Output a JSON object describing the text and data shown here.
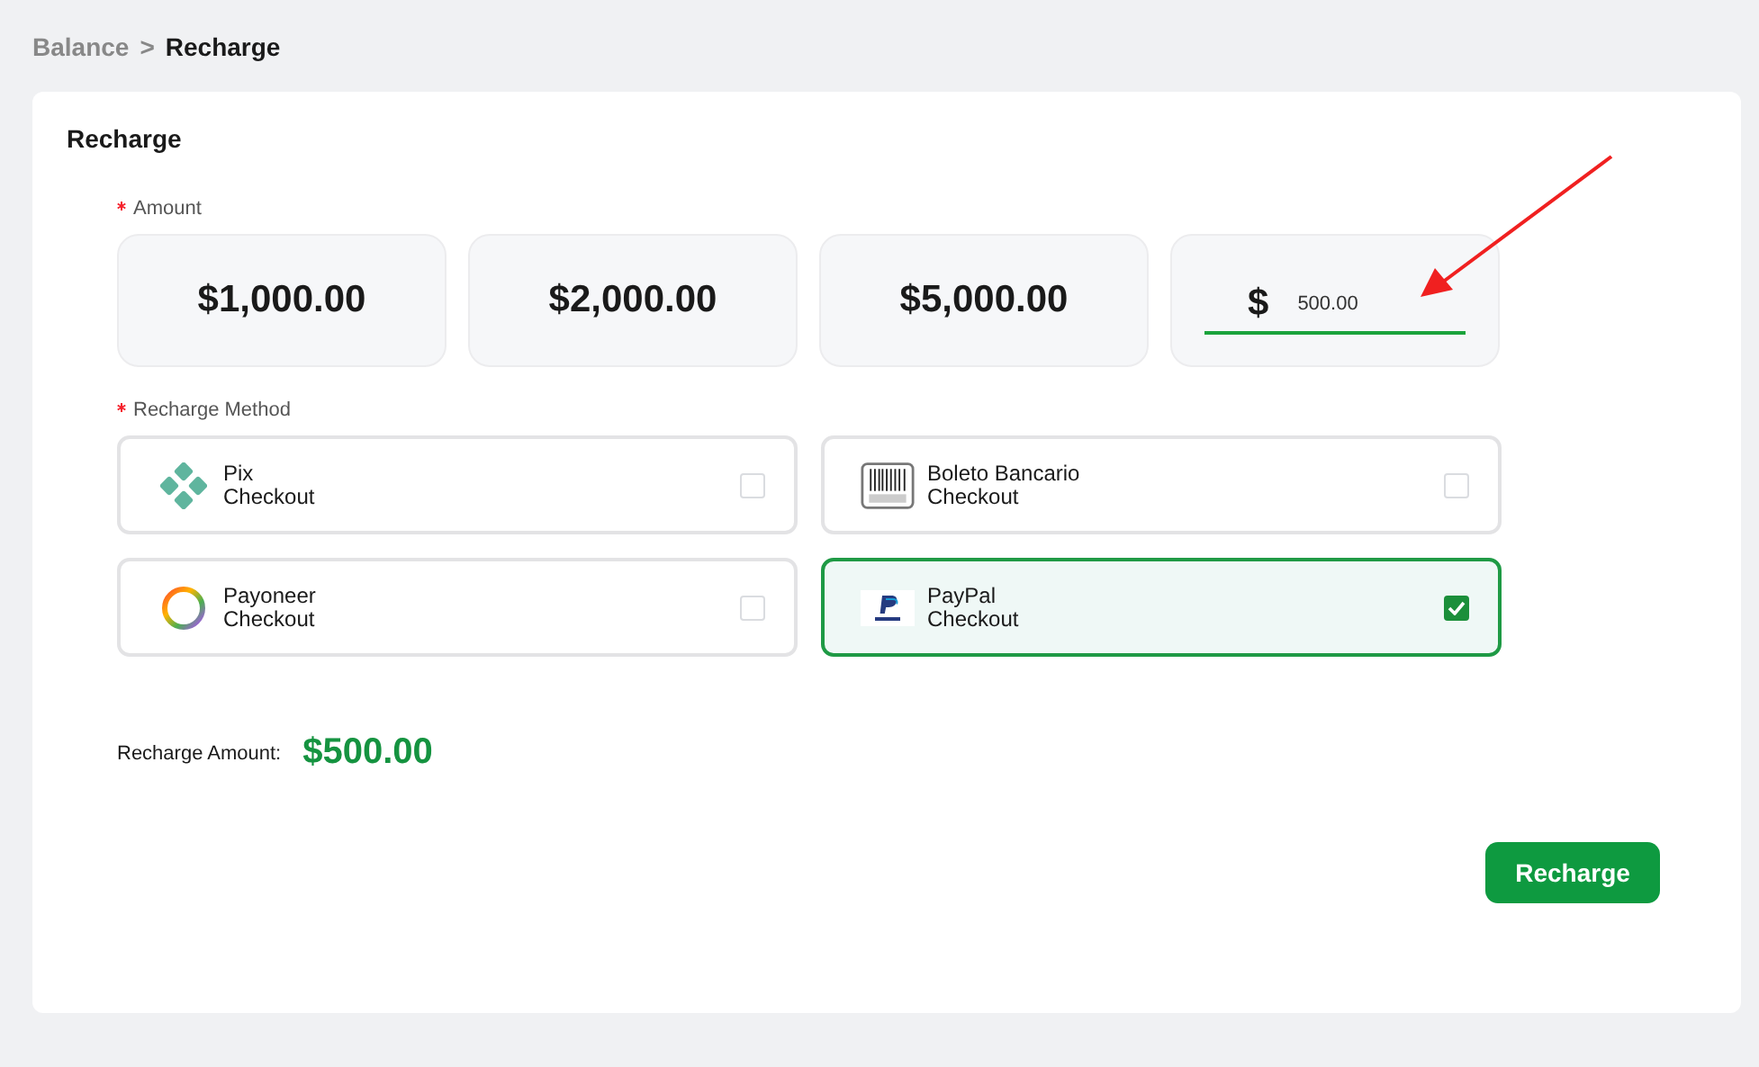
{
  "breadcrumb": {
    "parent": "Balance",
    "separator": ">",
    "current": "Recharge"
  },
  "card_title": "Recharge",
  "amount": {
    "label": "Amount",
    "required": true,
    "options": [
      {
        "text": "$1,000.00",
        "selected": false
      },
      {
        "text": "$2,000.00",
        "selected": false
      },
      {
        "text": "$5,000.00",
        "selected": false
      }
    ],
    "custom": {
      "currency": "$",
      "value": "500.00"
    }
  },
  "method": {
    "label": "Recharge Method",
    "required": true,
    "options": [
      {
        "kind": "pix",
        "name": "Pix",
        "sub": "Checkout",
        "selected": false
      },
      {
        "kind": "boleto",
        "name": "Boleto Bancario",
        "sub": "Checkout",
        "selected": false
      },
      {
        "kind": "payoneer",
        "name": "Payoneer",
        "sub": "Checkout",
        "selected": false
      },
      {
        "kind": "paypal",
        "name": "PayPal",
        "sub": "Checkout",
        "selected": true
      }
    ]
  },
  "summary": {
    "label": "Recharge Amount:",
    "value": "$500.00"
  },
  "submit": "Recharge"
}
